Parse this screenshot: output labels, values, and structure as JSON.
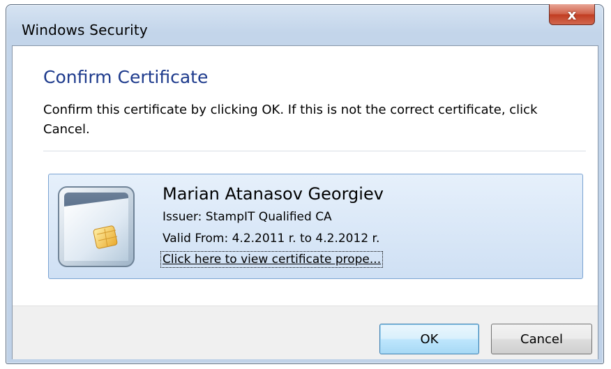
{
  "window": {
    "title": "Windows Security",
    "close_symbol": "x"
  },
  "dialog": {
    "heading": "Confirm Certificate",
    "description": "Confirm this certificate by clicking OK. If this is not the correct certificate, click Cancel."
  },
  "certificate": {
    "name": "Marian Atanasov Georgiev",
    "issuer": "Issuer: StampIT Qualified CA",
    "valid": "Valid From: 4.2.2011 r. to 4.2.2012 r.",
    "link": "Click here to view certificate prope...",
    "icon": "smart-card-icon"
  },
  "buttons": {
    "ok": "OK",
    "cancel": "Cancel"
  },
  "colors": {
    "heading": "#1d3a8c",
    "close_button": "#c13d22",
    "tile_border": "#7aa3d2",
    "default_button_border": "#3c7fb1"
  }
}
